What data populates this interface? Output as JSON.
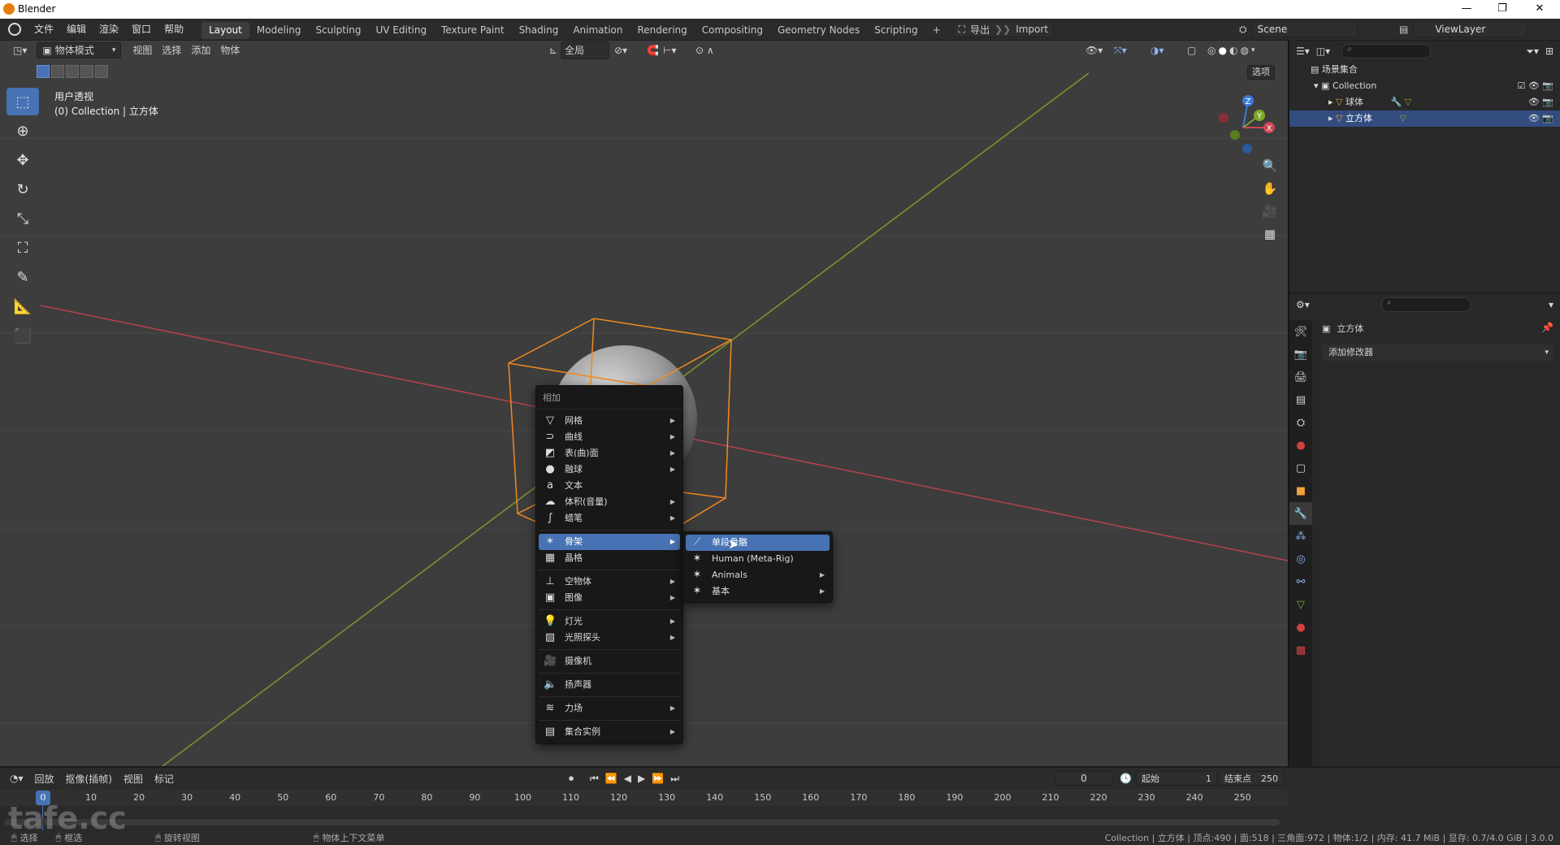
{
  "window": {
    "title": "Blender"
  },
  "top_menu": {
    "items": [
      "文件",
      "编辑",
      "渲染",
      "窗口",
      "帮助"
    ]
  },
  "workspaces": [
    "Layout",
    "Modeling",
    "Sculpting",
    "UV Editing",
    "Texture Paint",
    "Shading",
    "Animation",
    "Rendering",
    "Compositing",
    "Geometry Nodes",
    "Scripting"
  ],
  "active_workspace": "Layout",
  "addon_buttons": {
    "export": "导出",
    "import": "Import"
  },
  "scene": {
    "name": "Scene",
    "view_layer": "ViewLayer"
  },
  "viewport_header": {
    "mode": "物体模式",
    "menus": [
      "视图",
      "选择",
      "添加",
      "物体"
    ],
    "transform": "全局",
    "options": "选项"
  },
  "viewport_info": {
    "line1": "用户透视",
    "line2": "(0) Collection | 立方体"
  },
  "gizmo": {
    "z": "Z",
    "y": "Y",
    "x": "X"
  },
  "add_menu": {
    "title": "相加",
    "items": [
      {
        "label": "网格",
        "icon": "mesh-icon"
      },
      {
        "label": "曲线",
        "icon": "curve-icon"
      },
      {
        "label": "表(曲)面",
        "icon": "surface-icon"
      },
      {
        "label": "融球",
        "icon": "metaball-icon"
      },
      {
        "label": "文本",
        "icon": "text-icon"
      },
      {
        "label": "体积(音量)",
        "icon": "volume-icon"
      },
      {
        "label": "蜡笔",
        "icon": "grease-pencil-icon"
      },
      {
        "label": "骨架",
        "icon": "armature-icon"
      },
      {
        "label": "晶格",
        "icon": "lattice-icon"
      },
      {
        "label": "空物体",
        "icon": "empty-icon"
      },
      {
        "label": "图像",
        "icon": "image-icon"
      },
      {
        "label": "灯光",
        "icon": "light-icon"
      },
      {
        "label": "光照探头",
        "icon": "light-probe-icon"
      },
      {
        "label": "摄像机",
        "icon": "camera-icon"
      },
      {
        "label": "扬声器",
        "icon": "speaker-icon"
      },
      {
        "label": "力场",
        "icon": "force-field-icon"
      },
      {
        "label": "集合实例",
        "icon": "collection-instance-icon"
      }
    ]
  },
  "armature_submenu": {
    "items": [
      {
        "label": "单段骨骼"
      },
      {
        "label": "Human (Meta-Rig)"
      },
      {
        "label": "Animals"
      },
      {
        "label": "基本"
      }
    ]
  },
  "outliner": {
    "root": "场景集合",
    "collection": "Collection",
    "objects": [
      "球体",
      "立方体"
    ],
    "selected": "立方体"
  },
  "properties": {
    "object_name": "立方体",
    "add_modifier": "添加修改器"
  },
  "timeline": {
    "menus": [
      "回放",
      "抠像(插帧)",
      "视图",
      "标记"
    ],
    "current_frame": "0",
    "start_label": "起始",
    "start": "1",
    "end_label": "结束点",
    "end": "250",
    "ticks": [
      "0",
      "10",
      "20",
      "30",
      "40",
      "50",
      "60",
      "70",
      "80",
      "90",
      "100",
      "110",
      "120",
      "130",
      "140",
      "150",
      "160",
      "170",
      "180",
      "190",
      "200",
      "210",
      "220",
      "230",
      "240",
      "250"
    ]
  },
  "statusbar": {
    "select": "选择",
    "box": "框选",
    "rotate": "旋转视图",
    "context": "物体上下文菜单",
    "stats": "Collection | 立方体 | 顶点:490 | 面:518 | 三角面:972 | 物体:1/2 | 内存: 41.7 MiB | 显存: 0.7/4.0 GiB | 3.0.0"
  },
  "watermark": "tafe.cc",
  "colors": {
    "accent": "#4772b3",
    "selection_outline": "#f28a1e",
    "x_axis": "#c0404a",
    "y_axis": "#7a9a30"
  }
}
